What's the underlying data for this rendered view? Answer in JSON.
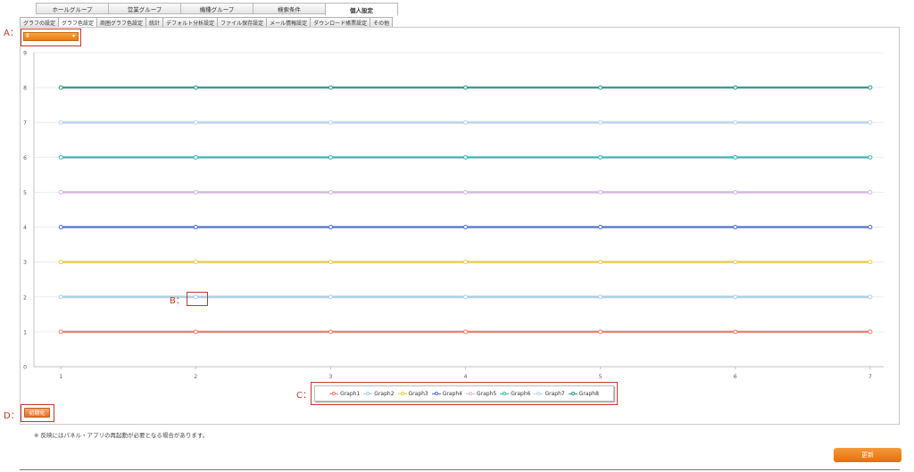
{
  "main_tabs": [
    {
      "label": "ホールグループ",
      "active": false
    },
    {
      "label": "営業グループ",
      "active": false
    },
    {
      "label": "機種グループ",
      "active": false
    },
    {
      "label": "検索条件",
      "active": false
    },
    {
      "label": "個人設定",
      "active": true
    }
  ],
  "sub_tabs": [
    {
      "label": "グラフの設定",
      "active": false
    },
    {
      "label": "グラフ色設定",
      "active": true
    },
    {
      "label": "商圏グラフ色設定",
      "active": false
    },
    {
      "label": "統計",
      "active": false
    },
    {
      "label": "デフォルト分析設定",
      "active": false
    },
    {
      "label": "ファイル保存設定",
      "active": false
    },
    {
      "label": "メール情報設定",
      "active": false
    },
    {
      "label": "ダウンロード帳票設定",
      "active": false
    },
    {
      "label": "その他",
      "active": false
    }
  ],
  "select": {
    "value": "8"
  },
  "annotations": {
    "a": "A：",
    "b": "B：",
    "c": "C：",
    "d": "D："
  },
  "chart_data": {
    "type": "line",
    "x": [
      1,
      2,
      3,
      4,
      5,
      6,
      7
    ],
    "xlim": [
      0.8,
      7.1
    ],
    "ylim": [
      0,
      9
    ],
    "yticks": [
      0,
      1,
      2,
      3,
      4,
      5,
      6,
      7,
      8,
      9
    ],
    "xticks": [
      1,
      2,
      3,
      4,
      5,
      6,
      7
    ],
    "grid": true,
    "legend_position": "bottom-center",
    "series": [
      {
        "name": "Graph1",
        "values": [
          1,
          1,
          1,
          1,
          1,
          1,
          1
        ],
        "color": "#ef7b68"
      },
      {
        "name": "Graph2",
        "values": [
          2,
          2,
          2,
          2,
          2,
          2,
          2
        ],
        "color": "#a9d0e6"
      },
      {
        "name": "Graph3",
        "values": [
          3,
          3,
          3,
          3,
          3,
          3,
          3
        ],
        "color": "#f2cc3c"
      },
      {
        "name": "Graph4",
        "values": [
          4,
          4,
          4,
          4,
          4,
          4,
          4
        ],
        "color": "#4f6fd6"
      },
      {
        "name": "Graph5",
        "values": [
          5,
          5,
          5,
          5,
          5,
          5,
          5
        ],
        "color": "#d8b8e0"
      },
      {
        "name": "Graph6",
        "values": [
          6,
          6,
          6,
          6,
          6,
          6,
          6
        ],
        "color": "#36b8b4"
      },
      {
        "name": "Graph7",
        "values": [
          7,
          7,
          7,
          7,
          7,
          7,
          7
        ],
        "color": "#b9d5ef"
      },
      {
        "name": "Graph8",
        "values": [
          8,
          8,
          8,
          8,
          8,
          8,
          8
        ],
        "color": "#2a9a8a"
      }
    ]
  },
  "buttons": {
    "init": "初期化",
    "update": "更新"
  },
  "note": "※ 反映にはパネル・アプリの再起動が必要となる場合があります。",
  "accent_color": "#e97c12"
}
